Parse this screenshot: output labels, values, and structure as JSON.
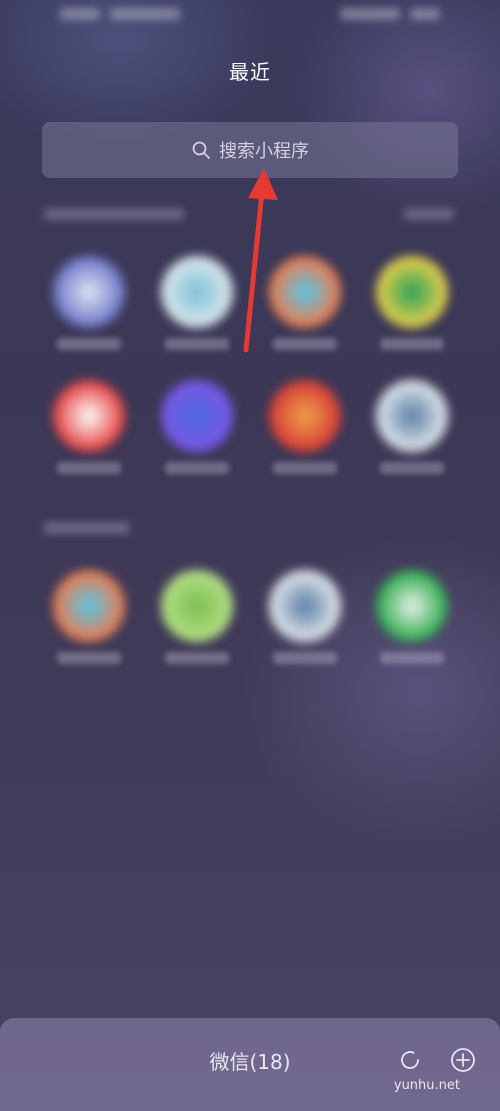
{
  "header": {
    "title": "最近"
  },
  "search": {
    "placeholder": "搜索小程序",
    "icon": "search-icon"
  },
  "recent_apps": [
    {
      "name": "",
      "colors": [
        "#6b74c6",
        "#dfe7f4"
      ]
    },
    {
      "name": "",
      "colors": [
        "#dfe7ee",
        "#7cc2d6"
      ]
    },
    {
      "name": "",
      "colors": [
        "#f07a4a",
        "#56c6e8"
      ]
    },
    {
      "name": "",
      "colors": [
        "#f0d24a",
        "#2aa05a"
      ]
    },
    {
      "name": "",
      "colors": [
        "#e43c3c",
        "#ffffff"
      ]
    },
    {
      "name": "",
      "colors": [
        "#7a56e6",
        "#4e6ae0"
      ]
    },
    {
      "name": "",
      "colors": [
        "#d53a36",
        "#f0a14a"
      ]
    },
    {
      "name": "",
      "colors": [
        "#e6eaee",
        "#5a7ea6"
      ]
    }
  ],
  "my_apps": [
    {
      "name": "",
      "colors": [
        "#f07a4a",
        "#56c6e8"
      ]
    },
    {
      "name": "",
      "colors": [
        "#b6e08a",
        "#7cbf4c"
      ]
    },
    {
      "name": "",
      "colors": [
        "#e6eaee",
        "#5a7ea6"
      ]
    },
    {
      "name": "",
      "colors": [
        "#2aa84a",
        "#e9f3ea"
      ]
    }
  ],
  "bottom_bar": {
    "label": "微信(18)",
    "refresh_icon": "refresh-icon",
    "add_icon": "add-icon"
  },
  "watermark": "yunhu.net",
  "colors": {
    "background": "#3f3a55",
    "arrow": "#e53935"
  }
}
